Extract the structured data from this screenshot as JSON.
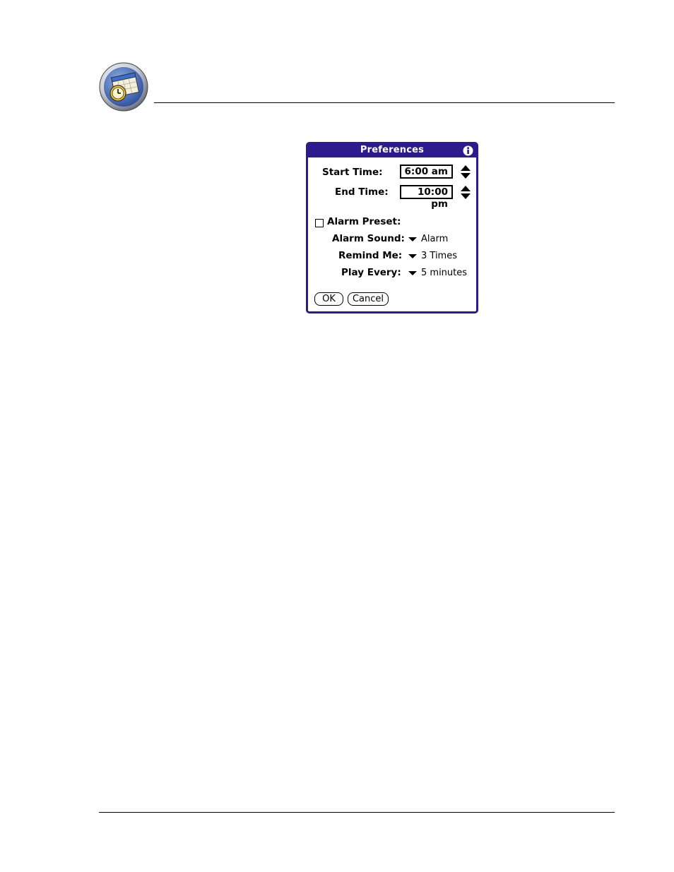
{
  "header": {
    "icon": "datebook-calendar-clock-icon"
  },
  "dialog": {
    "title": "Preferences",
    "info_icon": "info-icon",
    "start_time": {
      "label": "Start Time:",
      "value": "6:00 am"
    },
    "end_time": {
      "label": "End Time:",
      "value": "10:00 pm"
    },
    "alarm_preset": {
      "label": "Alarm Preset:",
      "checked": false
    },
    "alarm_sound": {
      "label": "Alarm Sound:",
      "value": "Alarm"
    },
    "remind_me": {
      "label": "Remind Me:",
      "value": "3 Times"
    },
    "play_every": {
      "label": "Play Every:",
      "value": "5 minutes"
    },
    "ok_label": "OK",
    "cancel_label": "Cancel"
  },
  "colors": {
    "title_bar": "#2e1a8f",
    "border": "#2e1a8f"
  }
}
